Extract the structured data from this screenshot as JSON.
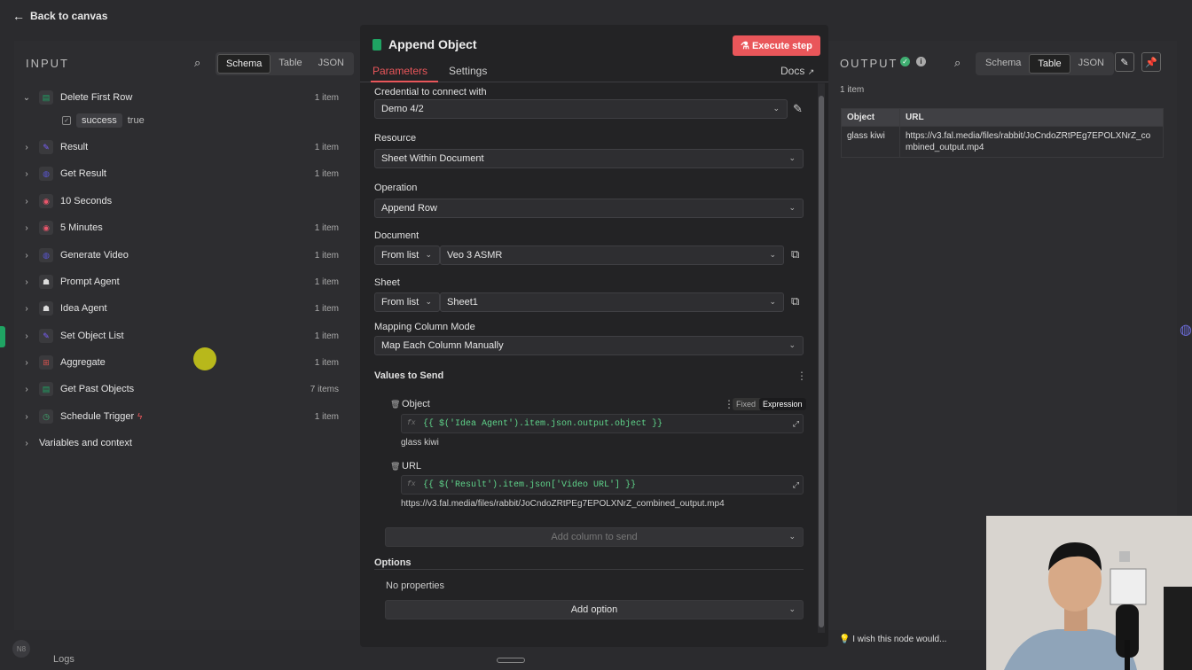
{
  "topbar": {
    "back_label": "Back to canvas"
  },
  "input": {
    "title": "INPUT",
    "tabs": [
      "Schema",
      "Table",
      "JSON"
    ],
    "active_tab": "Schema",
    "nodes": [
      {
        "name": "Delete First Row",
        "count": "1 item",
        "icon": "sheets-icon",
        "color": "#1fa463",
        "expanded": true
      },
      {
        "name": "Result",
        "count": "1 item",
        "icon": "pencil-icon",
        "color": "#7b61ff"
      },
      {
        "name": "Get Result",
        "count": "1 item",
        "icon": "globe-icon",
        "color": "#5b57d6"
      },
      {
        "name": "10 Seconds",
        "count": "",
        "icon": "wait-icon",
        "color": "#e9566b"
      },
      {
        "name": "5 Minutes",
        "count": "1 item",
        "icon": "wait-icon",
        "color": "#e9566b"
      },
      {
        "name": "Generate Video",
        "count": "1 item",
        "icon": "globe-icon",
        "color": "#5b57d6"
      },
      {
        "name": "Prompt Agent",
        "count": "1 item",
        "icon": "robot-icon",
        "color": "#dcdcdc"
      },
      {
        "name": "Idea Agent",
        "count": "1 item",
        "icon": "robot-icon",
        "color": "#dcdcdc"
      },
      {
        "name": "Set Object List",
        "count": "1 item",
        "icon": "pencil-icon",
        "color": "#7b61ff"
      },
      {
        "name": "Aggregate",
        "count": "1 item",
        "icon": "aggregate-icon",
        "color": "#d9534f"
      },
      {
        "name": "Get Past Objects",
        "count": "7 items",
        "icon": "sheets-icon",
        "color": "#1fa463"
      },
      {
        "name": "Schedule Trigger",
        "count": "1 item",
        "icon": "clock-icon",
        "color": "#3fae71"
      },
      {
        "name": "Variables and context",
        "count": "",
        "icon": "",
        "color": ""
      }
    ],
    "sub_field": {
      "key": "success",
      "value": "true"
    }
  },
  "node": {
    "title": "Append Object",
    "execute_label": "Execute step",
    "tabs": [
      "Parameters",
      "Settings"
    ],
    "docs_label": "Docs",
    "credential_label": "Credential to connect with",
    "credential_value": "Demo 4/2",
    "resource_label": "Resource",
    "resource_value": "Sheet Within Document",
    "operation_label": "Operation",
    "operation_value": "Append Row",
    "document_label": "Document",
    "document_mode": "From list",
    "document_value": "Veo 3 ASMR",
    "sheet_label": "Sheet",
    "sheet_mode": "From list",
    "sheet_value": "Sheet1",
    "mapping_label": "Mapping Column Mode",
    "mapping_value": "Map Each Column Manually",
    "values_label": "Values to Send",
    "object_label": "Object",
    "fixed_label": "Fixed",
    "expression_label": "Expression",
    "object_expr": "{{ $('Idea Agent').item.json.output.object }}",
    "object_result": "glass kiwi",
    "url_label": "URL",
    "url_expr": "{{ $('Result').item.json['Video URL'] }}",
    "url_result": "https://v3.fal.media/files/rabbit/JoCndoZRtPEg7EPOLXNrZ_combined_output.mp4",
    "add_column_label": "Add column to send",
    "options_label": "Options",
    "no_props": "No properties",
    "add_option_label": "Add option"
  },
  "output": {
    "title": "OUTPUT",
    "tabs": [
      "Schema",
      "Table",
      "JSON"
    ],
    "active_tab": "Table",
    "count": "1 item",
    "columns": [
      "Object",
      "URL"
    ],
    "row": {
      "object": "glass kiwi",
      "url": "https://v3.fal.media/files/rabbit/JoCndoZRtPEg7EPOLXNrZ_combined_output.mp4"
    }
  },
  "bottom": {
    "logs_label": "Logs",
    "wish_label": "I wish this node would..."
  },
  "colors": {
    "accent": "#e9565a",
    "success": "#3fae71",
    "expr_green": "#5fd38a"
  }
}
